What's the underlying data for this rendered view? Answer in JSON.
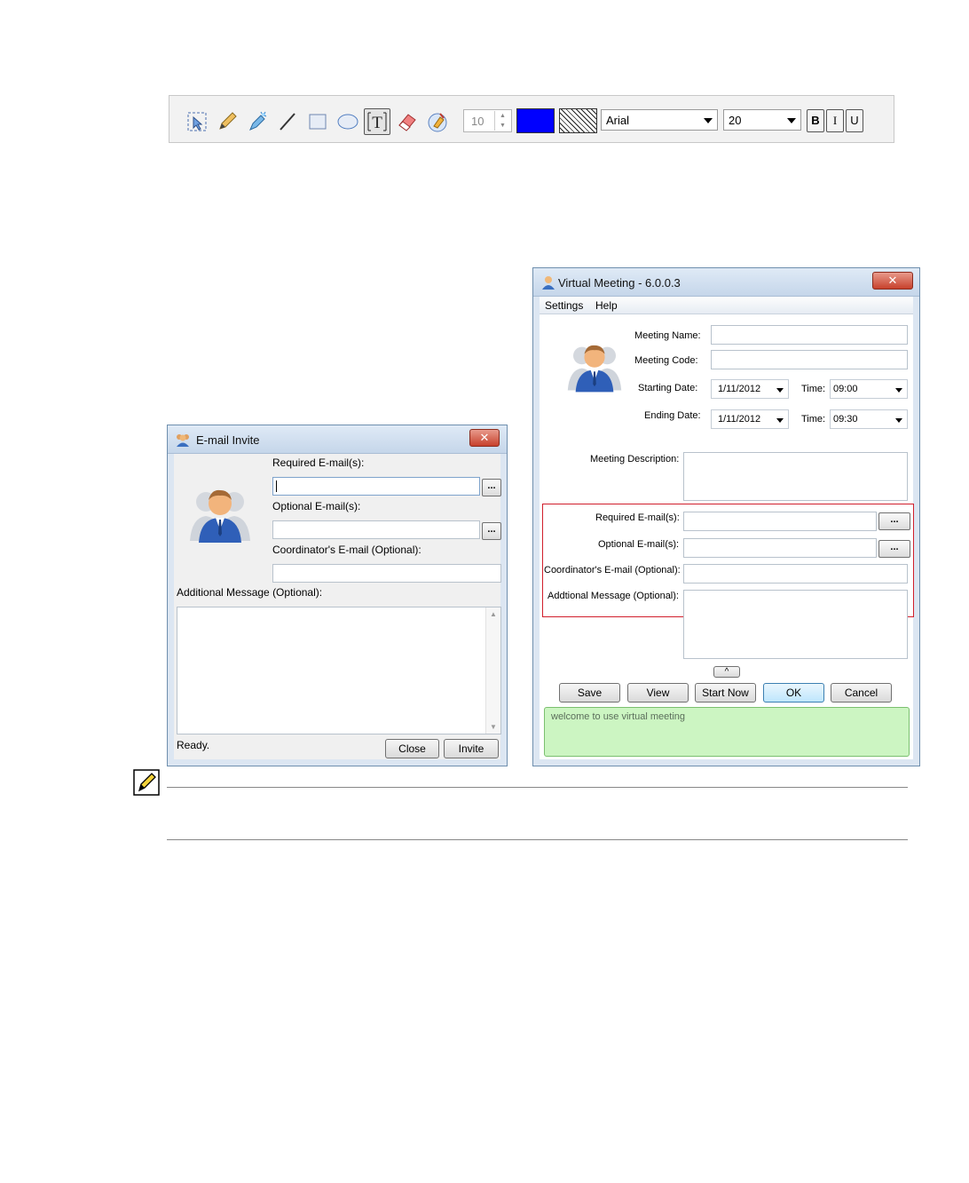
{
  "toolbar": {
    "tools": [
      "select-icon",
      "pencil-icon",
      "highlighter-icon",
      "line-icon",
      "rectangle-icon",
      "ellipse-icon",
      "text-tool-icon",
      "eraser-icon",
      "clear-brush-icon"
    ],
    "active_tool": "text-tool-icon",
    "line_width": "10",
    "color": "#0000ff",
    "font_name": "Arial",
    "font_size": "20",
    "bold_label": "B",
    "italic_label": "I",
    "underline_label": "U"
  },
  "email_invite": {
    "title": "E-mail Invite",
    "close_x": "✕",
    "required_label": "Required E-mail(s):",
    "optional_label": "Optional E-mail(s):",
    "coordinator_label": "Coordinator's E-mail (Optional):",
    "message_label": "Additional Message (Optional):",
    "browse_label": "...",
    "status": "Ready.",
    "close_button": "Close",
    "invite_button": "Invite"
  },
  "virtual_meeting": {
    "title": "Virtual Meeting - 6.0.0.3",
    "close_x": "✕",
    "menu": [
      "Settings",
      "Help"
    ],
    "meeting_name_label": "Meeting Name:",
    "meeting_code_label": "Meeting Code:",
    "starting_date_label": "Starting Date:",
    "ending_date_label": "Ending Date:",
    "time_label": "Time:",
    "start_date": "1/11/2012",
    "start_time": "09:00",
    "end_date": "1/11/2012",
    "end_time": "09:30",
    "description_label": "Meeting Description:",
    "required_label": "Required E-mail(s):",
    "optional_label": "Optional E-mail(s):",
    "coordinator_label": "Coordinator's E-mail (Optional):",
    "message_label": "Addtional Message (Optional):",
    "browse_label": "...",
    "collapse_label": "^",
    "buttons": {
      "save": "Save",
      "view": "View",
      "start_now": "Start Now",
      "ok": "OK",
      "cancel": "Cancel"
    },
    "status_message": "welcome to use virtual meeting"
  }
}
